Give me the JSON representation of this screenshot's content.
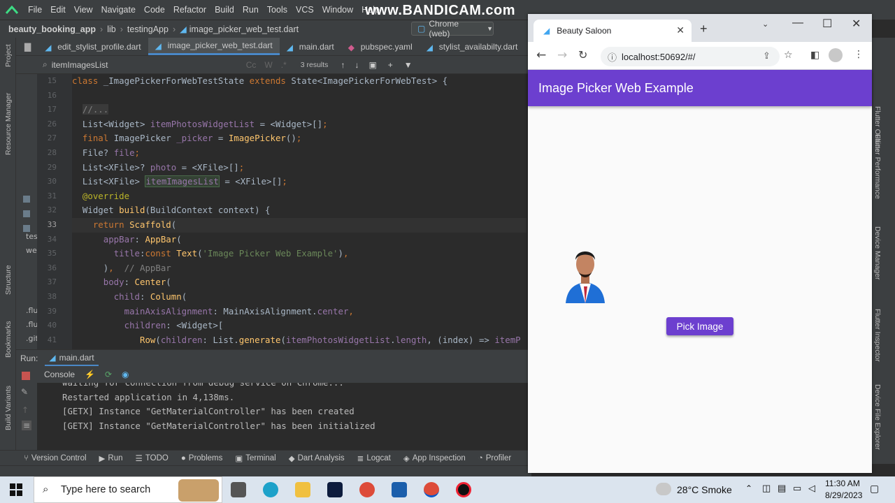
{
  "ide": {
    "menu": [
      "File",
      "Edit",
      "View",
      "Navigate",
      "Code",
      "Refactor",
      "Build",
      "Run",
      "Tools",
      "VCS",
      "Window",
      "Help"
    ],
    "watermark": "www.BANDICAM.com",
    "breadcrumb": [
      "beauty_booking_app",
      "lib",
      "testingApp",
      "image_picker_web_test.dart"
    ],
    "run_config": "Chrome (web)",
    "tabs": [
      "edit_stylist_profile.dart",
      "image_picker_web_test.dart",
      "main.dart",
      "pubspec.yaml",
      "stylist_availabilty.dart"
    ],
    "search": {
      "query": "itemImagesList",
      "results": "3 results"
    },
    "left_labels": [
      "Project",
      "Resource Manager",
      "Structure",
      "Bookmarks",
      "Build Variants"
    ],
    "right_labels": [
      "Flutter Outline",
      "Flutter Performance",
      "Device Manager",
      "Flutter Inspector",
      "Device File Explorer"
    ],
    "line_numbers": [
      "15",
      "16",
      "17",
      "26",
      "27",
      "28",
      "29",
      "30",
      "31",
      "32",
      "33",
      "34",
      "35",
      "36",
      "37",
      "38",
      "39",
      "40",
      "41"
    ],
    "project_files": [
      "tes",
      "we",
      ".flu",
      ".flu",
      ".git"
    ],
    "run_label": "Run:",
    "run_tab": "main.dart",
    "console_tab": "Console",
    "console": [
      "waiting for connection from debug service on Chrome...",
      "Restarted application in 4,138ms.",
      "[GETX] Instance \"GetMaterialController\" has been created",
      "[GETX] Instance \"GetMaterialController\" has been initialized"
    ],
    "bottom_tools": [
      "Version Control",
      "Run",
      "TODO",
      "Problems",
      "Terminal",
      "Dart Analysis",
      "Logcat",
      "App Inspection",
      "Profiler"
    ]
  },
  "browser": {
    "tab_title": "Beauty Saloon",
    "url": "localhost:50692/#/",
    "app_title": "Image Picker Web Example",
    "button_label": "Pick Image",
    "accent": "#6c3fcf"
  },
  "taskbar": {
    "search_placeholder": "Type here to search",
    "weather": "28°C  Smoke",
    "time": "11:30 AM",
    "date": "8/29/2023"
  }
}
